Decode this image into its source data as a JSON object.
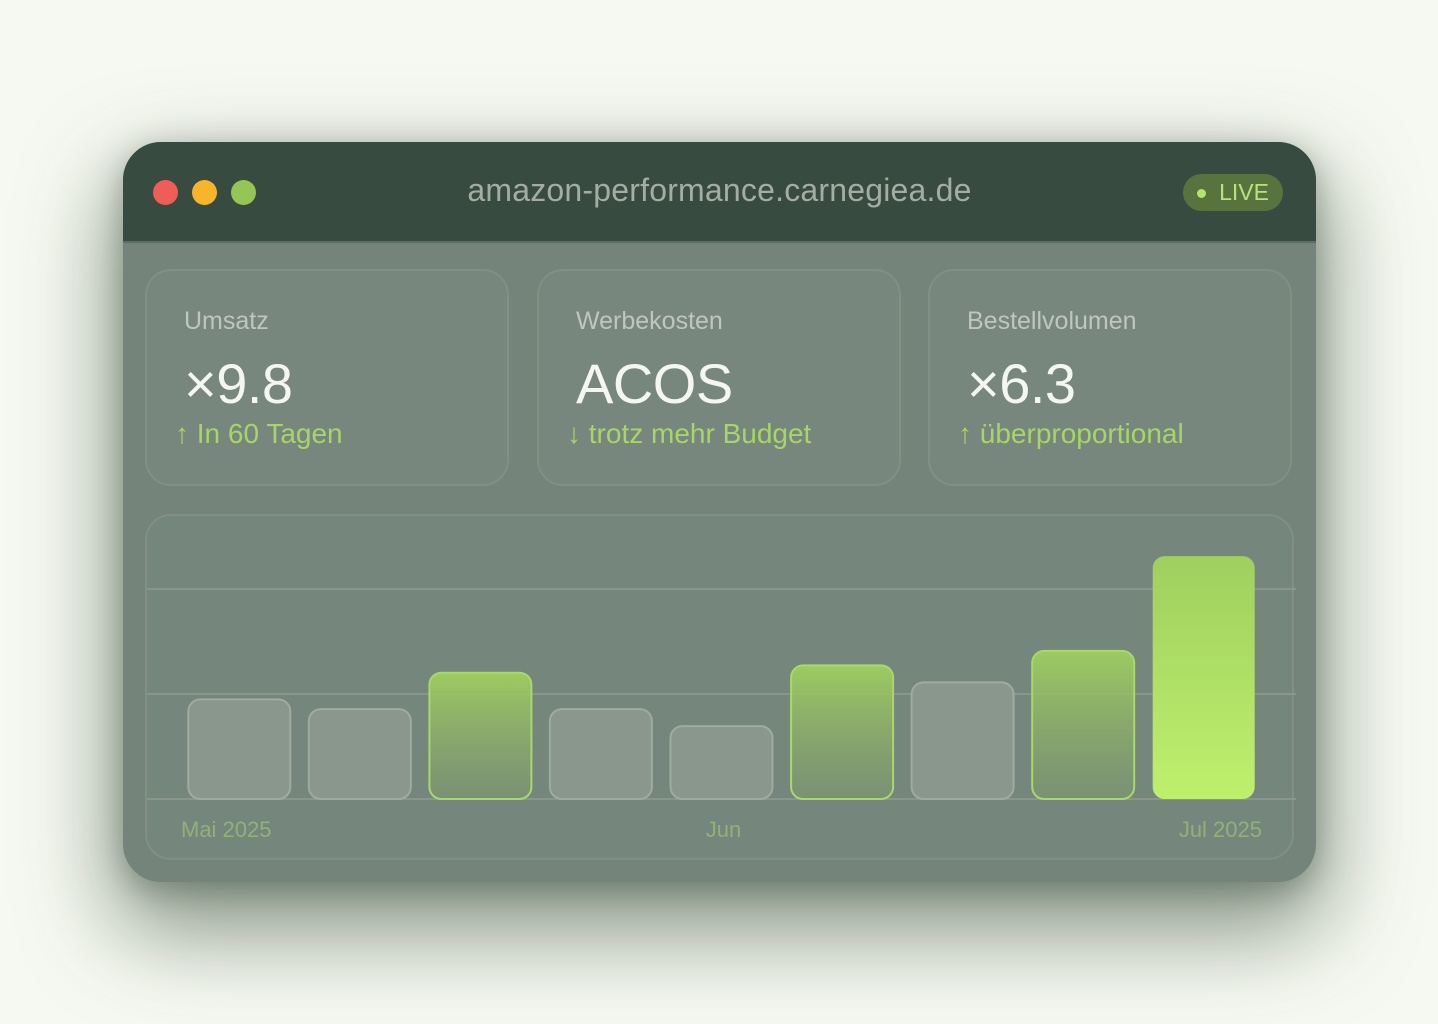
{
  "window": {
    "url": "amazon-performance.carnegiea.de",
    "live_label": "LIVE"
  },
  "kpis": [
    {
      "label": "Umsatz",
      "value": "×9.8",
      "note": "↑ In 60 Tagen"
    },
    {
      "label": "Werbekosten",
      "value": "ACOS",
      "note": "↓ trotz mehr Budget"
    },
    {
      "label": "Bestellvolumen",
      "value": "×6.3",
      "note": "↑ überproportional"
    }
  ],
  "colors": {
    "accent": "#a7d567",
    "bar_neutral": "#8a978c",
    "bar_highlight": "#9fcf5f",
    "bar_peak": "#bdee6a"
  },
  "chart_data": {
    "type": "bar",
    "x_labels": [
      "Mai 2025",
      "Jun",
      "Jul 2025"
    ],
    "values": [
      0.41,
      0.37,
      0.52,
      0.37,
      0.3,
      0.55,
      0.48,
      0.61,
      1.0
    ],
    "highlighted": [
      false,
      false,
      true,
      false,
      false,
      true,
      false,
      true,
      true
    ],
    "grid": true,
    "ylim": [
      0,
      1.05
    ]
  }
}
